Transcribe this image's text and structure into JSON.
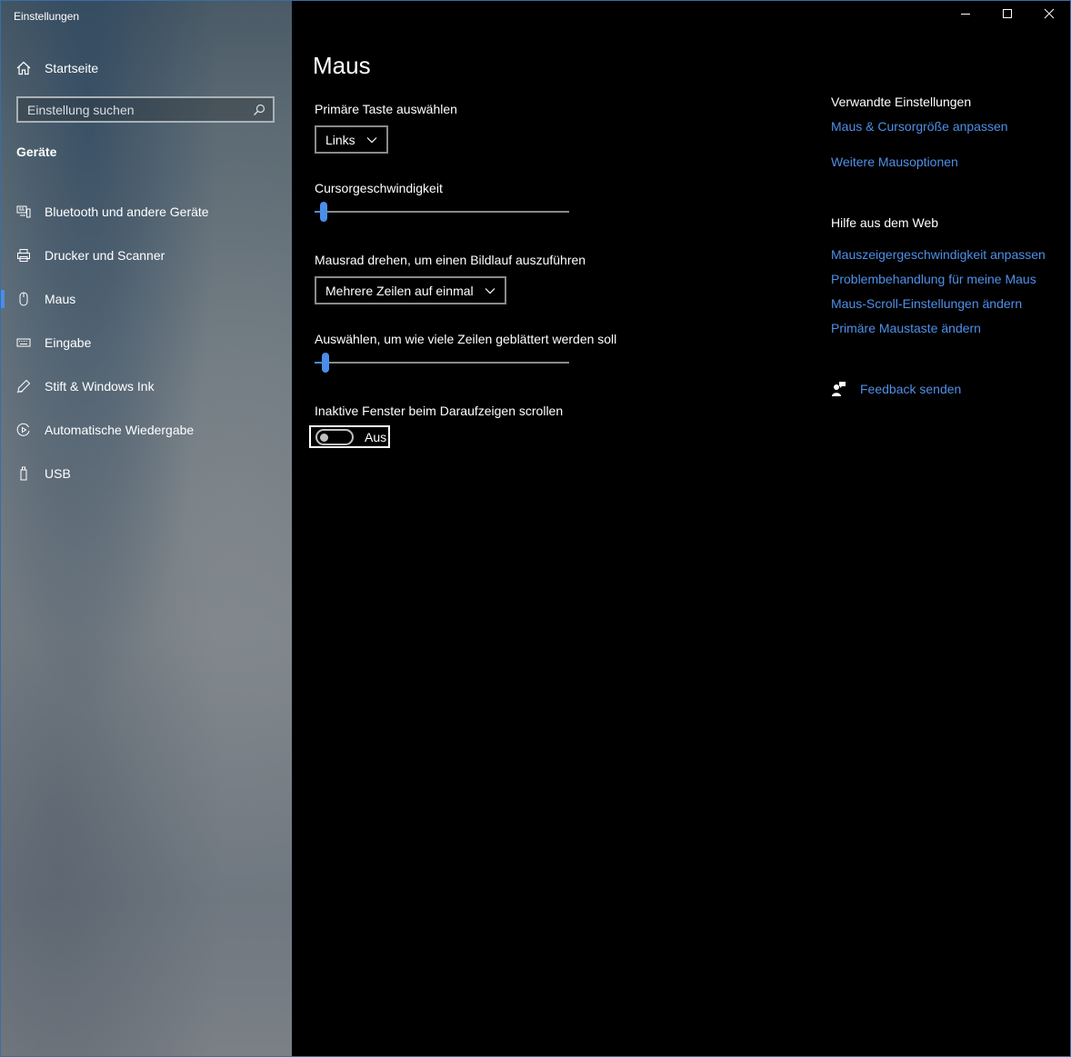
{
  "window": {
    "title": "Einstellungen"
  },
  "sidebar": {
    "home_label": "Startseite",
    "search_placeholder": "Einstellung suchen",
    "section_title": "Geräte",
    "items": [
      {
        "label": "Bluetooth und andere Geräte",
        "icon": "bluetooth-devices-icon"
      },
      {
        "label": "Drucker und Scanner",
        "icon": "printer-icon"
      },
      {
        "label": "Maus",
        "icon": "mouse-icon",
        "active": true
      },
      {
        "label": "Eingabe",
        "icon": "keyboard-icon"
      },
      {
        "label": "Stift & Windows Ink",
        "icon": "pen-icon"
      },
      {
        "label": "Automatische Wiedergabe",
        "icon": "autoplay-icon"
      },
      {
        "label": "USB",
        "icon": "usb-icon"
      }
    ]
  },
  "main": {
    "title": "Maus",
    "primary_button": {
      "label": "Primäre Taste auswählen",
      "value": "Links"
    },
    "cursor_speed": {
      "label": "Cursorgeschwindigkeit",
      "level": 0.02
    },
    "scroll_mode": {
      "label": "Mausrad drehen, um einen Bildlauf auszuführen",
      "value": "Mehrere Zeilen auf einmal"
    },
    "scroll_lines": {
      "label": "Auswählen, um wie viele Zeilen geblättert werden soll",
      "level": 0.03
    },
    "inactive_scroll": {
      "label": "Inaktive Fenster beim Daraufzeigen scrollen",
      "state": "Aus",
      "on": false
    }
  },
  "related": {
    "heading": "Verwandte Einstellungen",
    "links": [
      "Maus & Cursorgröße anpassen",
      "Weitere Mausoptionen"
    ]
  },
  "web_help": {
    "heading": "Hilfe aus dem Web",
    "links": [
      "Mauszeigergeschwindigkeit anpassen",
      "Problembehandlung für meine Maus",
      "Maus-Scroll-Einstellungen ändern",
      "Primäre Maustaste ändern"
    ]
  },
  "feedback": {
    "label": "Feedback senden"
  },
  "colors": {
    "accent": "#4a8ee8",
    "link": "#4f8fe8",
    "background": "#000000"
  }
}
